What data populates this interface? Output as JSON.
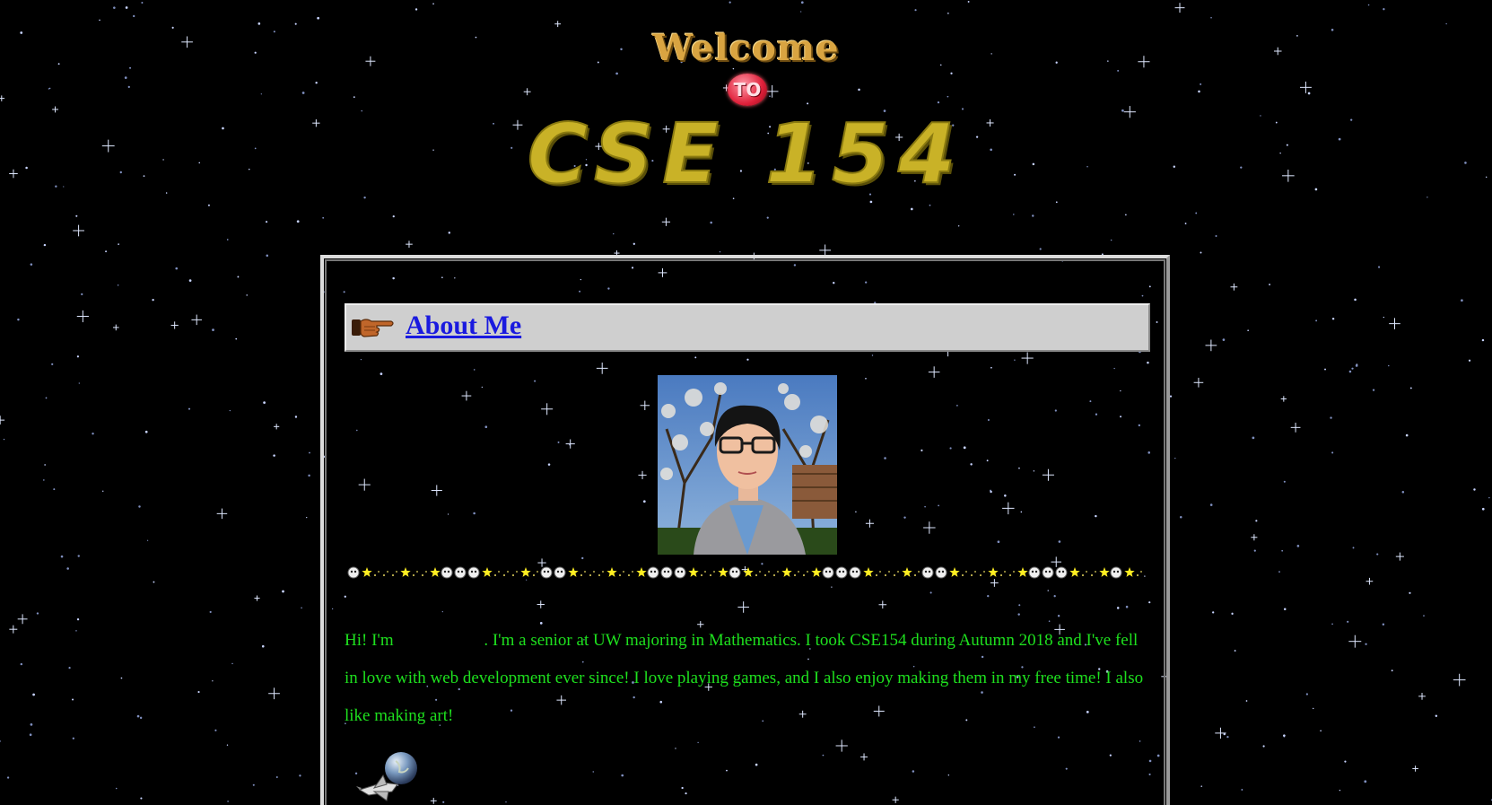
{
  "header": {
    "welcome": "Welcome",
    "to": "TO",
    "course": "CSE 154"
  },
  "section": {
    "title": "About Me",
    "icon": "pointing-hand-icon"
  },
  "divider": {
    "pattern": "☻★｡･:*:･ﾟ★☻☻☻★"
  },
  "bio": {
    "greeting": "Hi! I'm",
    "name": "",
    "text": ". I'm a senior at UW majoring in Mathematics. I took CSE154 during Autumn 2018 and I've fell in love with web development ever since! I love playing games, and I also enjoy making them in my free time! I also like making art!"
  },
  "decor": {
    "footer_icon": "space-shuttle-earth-icon"
  },
  "colors": {
    "background": "#000000",
    "bio_text": "#1ee01e",
    "link": "#1a1adf",
    "gold": "#c9b227",
    "section_bar": "#cfcfcf"
  }
}
